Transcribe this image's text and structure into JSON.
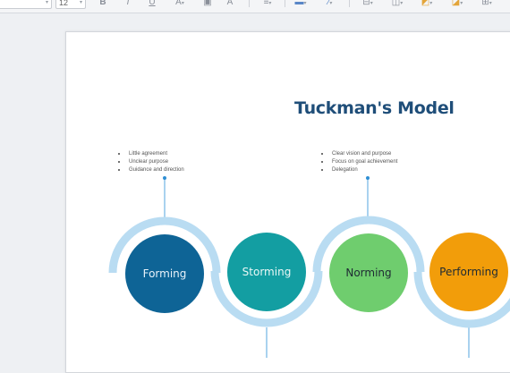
{
  "toolbar": {
    "font_size": "12",
    "icons": [
      "bold-icon",
      "italic-icon",
      "underline-icon",
      "font-color-icon",
      "image-icon",
      "text-icon",
      "align-icon",
      "fill-color-icon",
      "line-color-icon",
      "arrange-icon",
      "shadow-icon",
      "connector-icon"
    ]
  },
  "diagram": {
    "title": "Tuckman's Model",
    "top_notes": [
      {
        "items": [
          "Little agreement",
          "Unclear purpose",
          "Guidance and direction"
        ]
      },
      {
        "items": [
          "Clear vision and purpose",
          "Focus on goal achievement",
          "Delegation"
        ]
      }
    ],
    "stages": [
      {
        "label": "Forming",
        "color": "#0e6496"
      },
      {
        "label": "Storming",
        "color": "#139ea2"
      },
      {
        "label": "Norming",
        "color": "#6fcd6e"
      },
      {
        "label": "Performing",
        "color": "#f29d0a"
      }
    ],
    "ribbon_color": "#b9dcf2",
    "connector_color": "#a9d2ef"
  }
}
